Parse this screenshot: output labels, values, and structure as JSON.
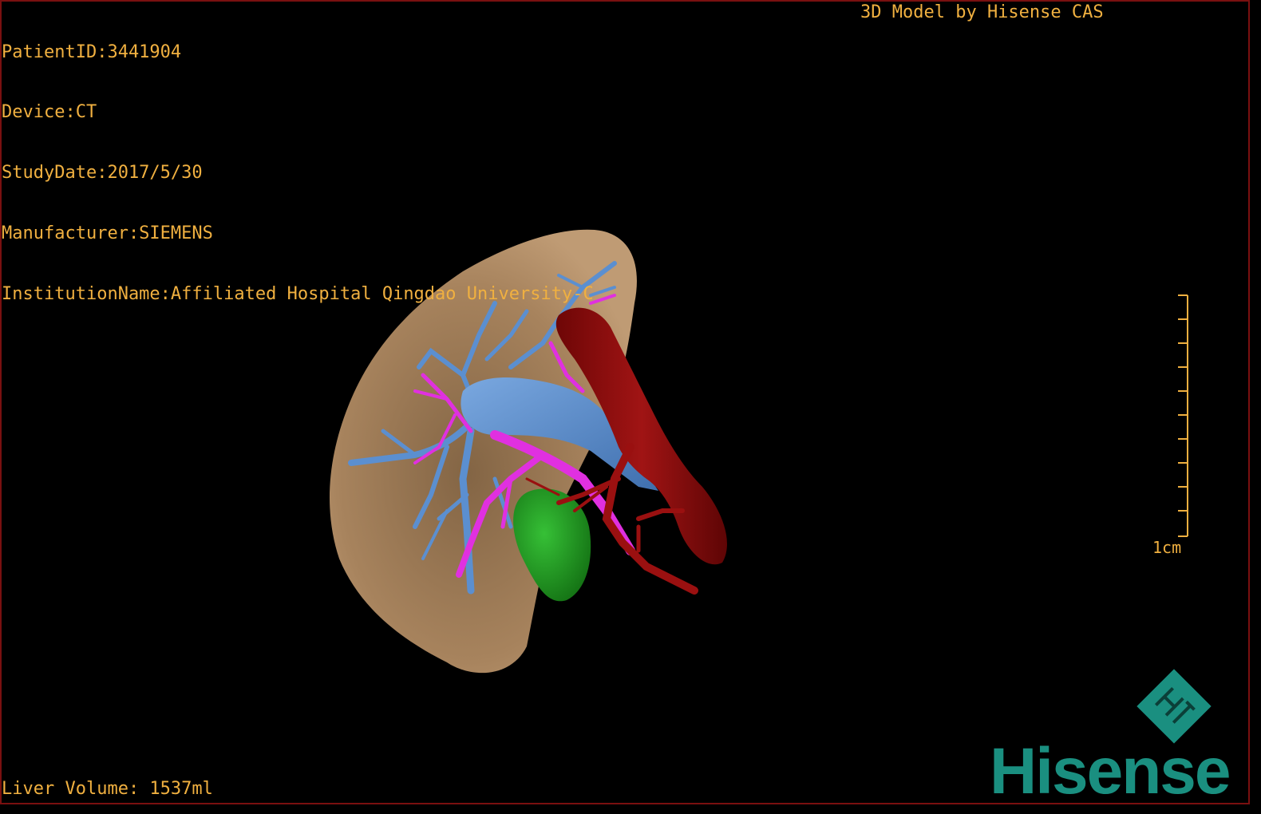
{
  "overlay": {
    "patient_id": "PatientID:3441904",
    "device": "Device:CT",
    "study_date": "StudyDate:2017/5/30",
    "manufacturer": "Manufacturer:SIEMENS",
    "institution": "InstitutionName:Affiliated Hospital Qingdao University-C",
    "model_credit": "3D Model by Hisense CAS",
    "liver_volume": "Liver Volume: 1537ml",
    "scale_label": "1cm"
  },
  "logo": {
    "wordmark": "Hisense",
    "mark_glyph": "HT"
  },
  "colors": {
    "overlay_text": "#f0b040",
    "liver": "#b08860",
    "portal_vein": "#5b8fd0",
    "hepatic_artery": "#8b0a0a",
    "bile_vessels": "#e030e0",
    "gallbladder": "#1fa01f",
    "brand": "#1a8f80"
  },
  "scene": {
    "icons": [
      "liver-model",
      "portal-vein-model",
      "aorta-model",
      "hepatic-vessels-model",
      "gallbladder-model"
    ]
  }
}
